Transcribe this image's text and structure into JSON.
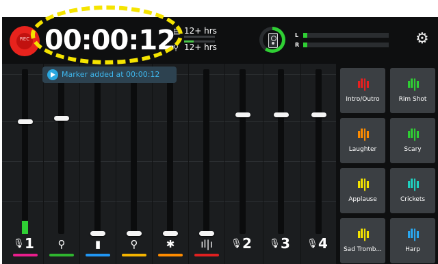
{
  "app": {
    "record_button_label": "REC",
    "timer": "00:00:12",
    "storage": [
      {
        "icon": "sd-card-icon",
        "text": "12+ hrs",
        "fill_fraction": 0.0
      },
      {
        "icon": "usb-icon",
        "text": "12+ hrs",
        "fill_fraction": 0.3
      }
    ],
    "monitor": {
      "icon": "speaker-icon",
      "level_fraction": 0.6,
      "left_label": "L",
      "right_label": "R",
      "left_level": 0.05,
      "right_level": 0.05
    },
    "settings_icon": "gear-icon"
  },
  "marker": {
    "text": "Marker added at 00:00:12",
    "icon": "marker-flag-icon"
  },
  "channels": [
    {
      "label": "1",
      "icon": "microphone-icon",
      "color": "#e91e8c",
      "fader_level": 0.68,
      "meter_level": 0.08
    },
    {
      "label": "",
      "icon": "usb-icon",
      "color": "#2fb52f",
      "fader_level": 0.7,
      "meter_level": 0
    },
    {
      "label": "",
      "icon": "phone-1-icon",
      "color": "#2196f3",
      "fader_level": 0.0,
      "meter_level": 0
    },
    {
      "label": "",
      "icon": "usb-2-icon",
      "color": "#f5b400",
      "fader_level": 0.0,
      "meter_level": 0
    },
    {
      "label": "",
      "icon": "bluetooth-icon",
      "color": "#ff8c00",
      "fader_level": 0.0,
      "meter_level": 0
    },
    {
      "label": "",
      "icon": "soundpad-icon",
      "color": "#e02020",
      "fader_level": 0.0,
      "meter_level": 0
    },
    {
      "label": "2",
      "icon": "microphone-icon",
      "color": "",
      "fader_level": 0.72,
      "meter_level": 0
    },
    {
      "label": "3",
      "icon": "microphone-icon",
      "color": "",
      "fader_level": 0.72,
      "meter_level": 0
    },
    {
      "label": "4",
      "icon": "microphone-icon",
      "color": "",
      "fader_level": 0.72,
      "meter_level": 0
    }
  ],
  "pads": [
    {
      "label": "Intro/Outro",
      "color": "#e82020"
    },
    {
      "label": "Rim Shot",
      "color": "#2fcf34"
    },
    {
      "label": "Laughter",
      "color": "#ff8c00"
    },
    {
      "label": "Scary",
      "color": "#2fcf34"
    },
    {
      "label": "Applause",
      "color": "#f5e400"
    },
    {
      "label": "Crickets",
      "color": "#1fd1c0"
    },
    {
      "label": "Sad Tromb...",
      "color": "#f5e400"
    },
    {
      "label": "Harp",
      "color": "#2aa8f0"
    }
  ],
  "pad_glyph": "ıl|ı"
}
